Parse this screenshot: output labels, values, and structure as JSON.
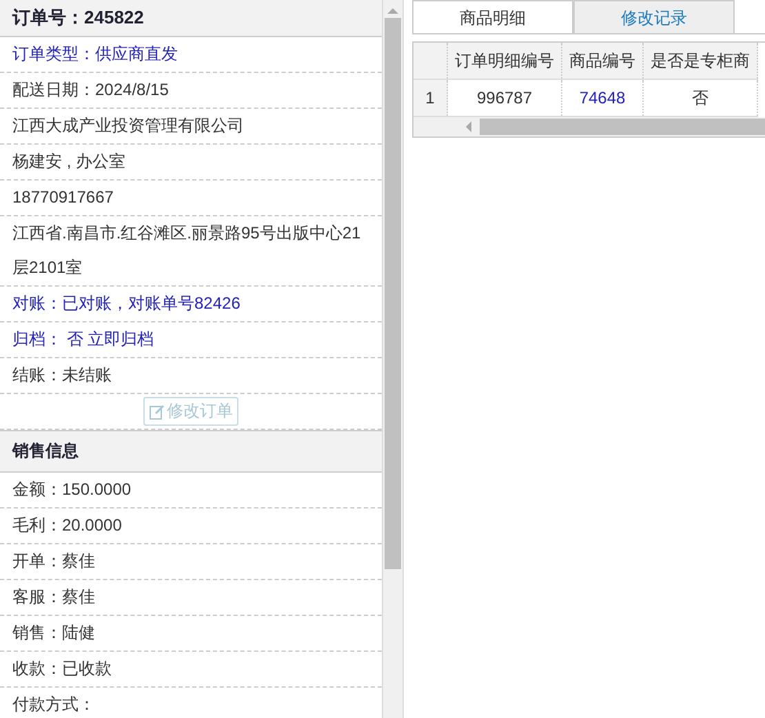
{
  "order_panel": {
    "title": "订单号：245822",
    "rows": [
      {
        "text": "订单类型：供应商直发",
        "kind": "link"
      },
      {
        "text": "配送日期：2024/8/15",
        "kind": "text"
      },
      {
        "text": "江西大成产业投资管理有限公司",
        "kind": "text"
      },
      {
        "text": "杨建安 , 办公室",
        "kind": "text"
      },
      {
        "text": "18770917667",
        "kind": "text"
      },
      {
        "text": "江西省.南昌市.红谷滩区.丽景路95号出版中心21层2101室",
        "kind": "text"
      },
      {
        "text": "对账：已对账，对账单号82426",
        "kind": "link"
      },
      {
        "text": "归档： 否 立即归档",
        "kind": "link"
      },
      {
        "text": "结账：未结账",
        "kind": "text"
      }
    ],
    "edit_button": {
      "label": "修改订单",
      "disabled": true
    },
    "section_title": "销售信息",
    "sales_rows": [
      "金额：150.0000",
      "毛利：20.0000",
      "开单：蔡佳",
      "客服：蔡佳",
      "销售：陆健",
      "收款：已收款",
      "付款方式："
    ]
  },
  "tabs": [
    {
      "label": "商品明细",
      "selected": true
    },
    {
      "label": "修改记录",
      "selected": false
    }
  ],
  "table": {
    "columns": [
      "订单明细编号",
      "商品编号",
      "是否是专柜商"
    ],
    "rows": [
      {
        "index": "1",
        "cells": [
          {
            "text": "996787",
            "kind": "text"
          },
          {
            "text": "74648",
            "kind": "link"
          },
          {
            "text": "否",
            "kind": "text"
          }
        ]
      }
    ]
  }
}
